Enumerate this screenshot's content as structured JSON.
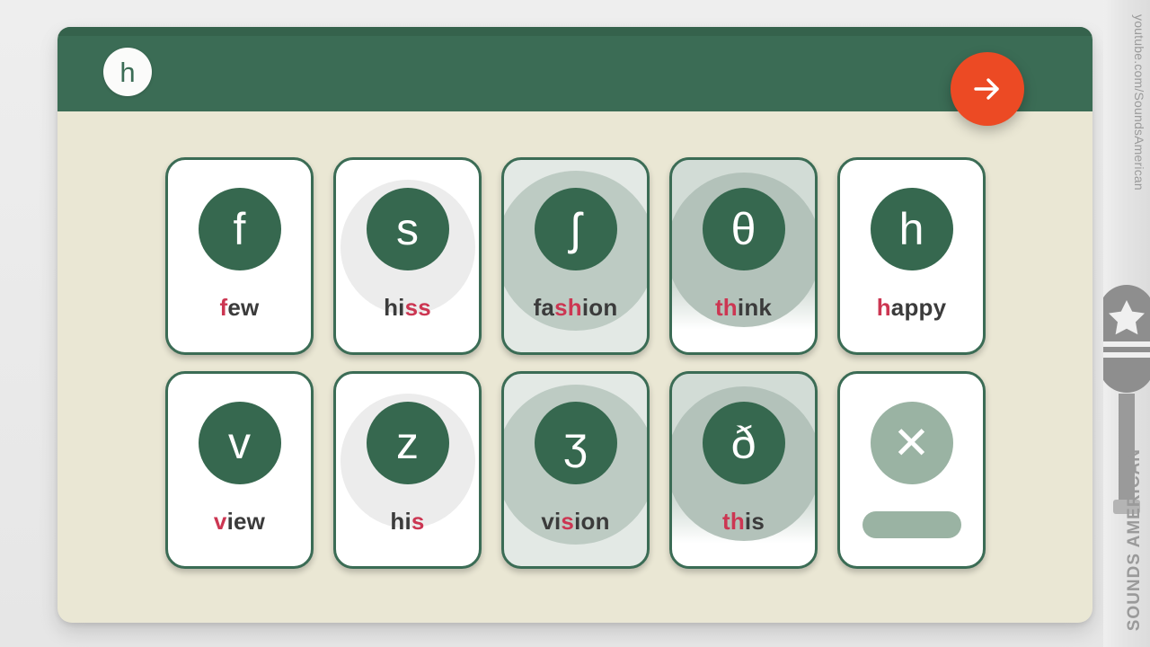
{
  "app": {
    "background_color": "#e9e9e9",
    "panel_color": "#eae7d4",
    "header_color": "#3b6c55",
    "accent_color": "#ec4a24",
    "highlight_color": "#cc3652",
    "circle_color": "#36684f"
  },
  "header": {
    "badge_symbol": "h",
    "next_label": "Next",
    "next_icon": "arrow-right-icon"
  },
  "cards": [
    {
      "symbol": "f",
      "word_pre": "",
      "word_hl": "f",
      "word_post": "ew",
      "state": "plain",
      "kind": "phoneme"
    },
    {
      "symbol": "s",
      "word_pre": "hi",
      "word_hl": "ss",
      "word_post": "",
      "state": "faint",
      "kind": "phoneme"
    },
    {
      "symbol": "ʃ",
      "word_pre": "fa",
      "word_hl": "sh",
      "word_post": "ion",
      "state": "mid",
      "kind": "phoneme"
    },
    {
      "symbol": "θ",
      "word_pre": "",
      "word_hl": "th",
      "word_post": "ink",
      "state": "strong",
      "kind": "phoneme"
    },
    {
      "symbol": "h",
      "word_pre": "",
      "word_hl": "h",
      "word_post": "appy",
      "state": "plain",
      "kind": "phoneme"
    },
    {
      "symbol": "v",
      "word_pre": "",
      "word_hl": "v",
      "word_post": "iew",
      "state": "plain",
      "kind": "phoneme"
    },
    {
      "symbol": "z",
      "word_pre": "hi",
      "word_hl": "s",
      "word_post": "",
      "state": "faint",
      "kind": "phoneme"
    },
    {
      "symbol": "ʒ",
      "word_pre": "vi",
      "word_hl": "s",
      "word_post": "ion",
      "state": "mid",
      "kind": "phoneme"
    },
    {
      "symbol": "ð",
      "word_pre": "",
      "word_hl": "th",
      "word_post": "is",
      "state": "strong",
      "kind": "phoneme"
    },
    {
      "symbol": "✕",
      "word_pre": "",
      "word_hl": "",
      "word_post": "",
      "state": "plain",
      "kind": "close"
    }
  ],
  "rail": {
    "url_text": "youtube.com/SoundsAmerican",
    "brand_text": "SOUNDS AMERICAN",
    "logo_icon": "microphone-star-icon"
  }
}
